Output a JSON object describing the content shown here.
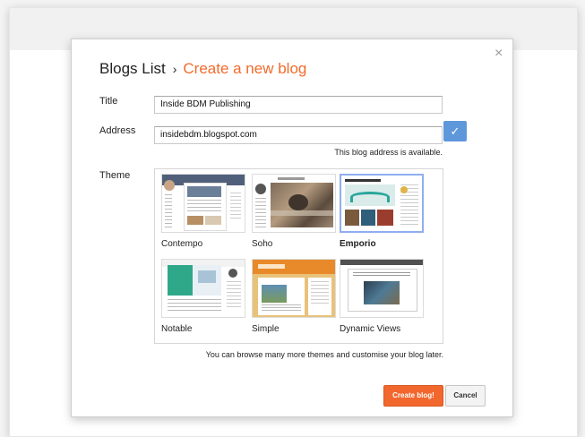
{
  "dialog": {
    "breadcrumb_parent": "Blogs List",
    "breadcrumb_separator": "›",
    "breadcrumb_current": "Create a new blog",
    "close_icon": "×"
  },
  "form": {
    "title_label": "Title",
    "title_value": "Inside BDM Publishing",
    "address_label": "Address",
    "address_value": "insidebdm.blogspot.com",
    "address_check_icon": "✓",
    "address_status": "This blog address is available.",
    "theme_label": "Theme"
  },
  "themes": [
    {
      "name": "Contempo",
      "selected": false
    },
    {
      "name": "Soho",
      "selected": false
    },
    {
      "name": "Emporio",
      "selected": true
    },
    {
      "name": "Notable",
      "selected": false
    },
    {
      "name": "Simple",
      "selected": false
    },
    {
      "name": "Dynamic Views",
      "selected": false
    }
  ],
  "theme_note": "You can browse many more themes and customise your blog later.",
  "buttons": {
    "create": "Create blog!",
    "cancel": "Cancel"
  },
  "colors": {
    "accent": "#f26b2b",
    "create_button": "#f2672d",
    "check_button": "#5f97db",
    "selected_border": "#8faef0"
  }
}
